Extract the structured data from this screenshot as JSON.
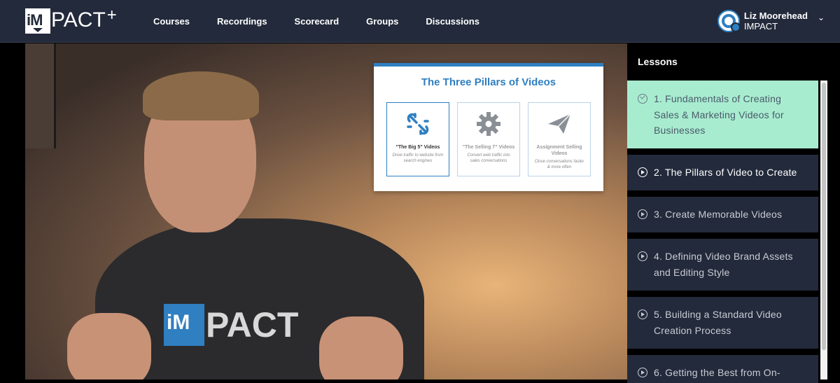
{
  "brand": {
    "logo_box": "iM",
    "logo_text": "PACT",
    "logo_plus": "+"
  },
  "nav": {
    "items": [
      {
        "label": "Courses"
      },
      {
        "label": "Recordings"
      },
      {
        "label": "Scorecard"
      },
      {
        "label": "Groups"
      },
      {
        "label": "Discussions"
      }
    ]
  },
  "user": {
    "name": "Liz Moorehead",
    "org": "IMPACT",
    "menu_icon": "chevron-down-icon"
  },
  "video": {
    "shirt_logo_box": "iM",
    "shirt_logo_text": "PACT",
    "overlay": {
      "title": "The Three Pillars of Videos",
      "cards": [
        {
          "icon": "broken-link-icon",
          "title": "\"The Big 5\" Videos",
          "subtitle": "Drive traffic to website from search engines"
        },
        {
          "icon": "gear-icon",
          "title": "\"The Selling 7\" Videos",
          "subtitle": "Convert web traffic into sales conversations"
        },
        {
          "icon": "paper-plane-icon",
          "title": "Assignment Selling Videos",
          "subtitle": "Close conversations faster & more often"
        }
      ]
    }
  },
  "sidebar": {
    "title": "Lessons",
    "lessons": [
      {
        "label": "1. Fundamentals of Creating Sales & Marketing Videos for Businesses",
        "status": "completed",
        "icon": "check-circle-icon"
      },
      {
        "label": "2. The Pillars of Video to Create",
        "status": "current",
        "icon": "play-circle-icon"
      },
      {
        "label": "3. Create Memorable Videos",
        "status": "pending",
        "icon": "play-circle-icon"
      },
      {
        "label": "4. Defining Video Brand Assets and Editing Style",
        "status": "pending",
        "icon": "play-circle-icon"
      },
      {
        "label": "5. Building a Standard Video Creation Process",
        "status": "pending",
        "icon": "play-circle-icon"
      },
      {
        "label": "6. Getting the Best from On-",
        "status": "pending",
        "icon": "play-circle-icon"
      }
    ]
  },
  "colors": {
    "topbar": "#232a3b",
    "accent": "#2f7fc1",
    "active_lesson": "#a8ecd0",
    "lesson_bg": "#232a3b"
  }
}
